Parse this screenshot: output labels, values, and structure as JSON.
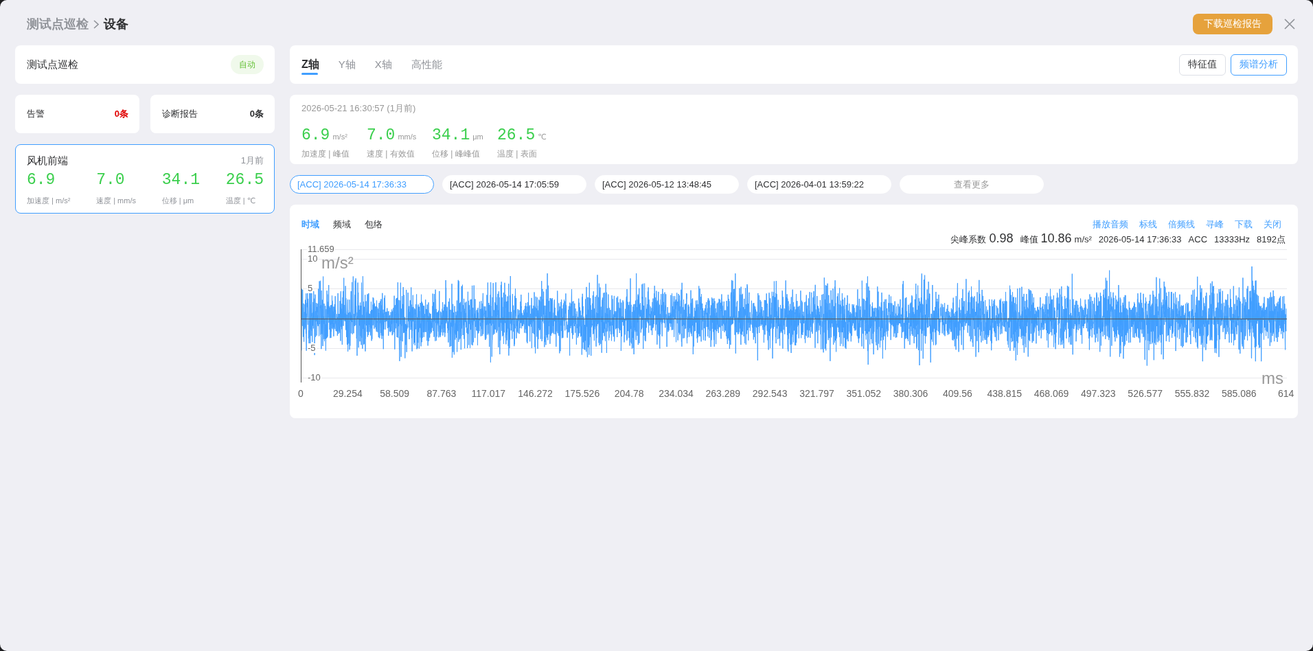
{
  "breadcrumb": [
    {
      "label": "测试点巡检",
      "current": false
    },
    {
      "label": "设备",
      "current": true
    }
  ],
  "header": {
    "download_button": "下载巡检报告"
  },
  "sidebar": {
    "patrol_card": {
      "title": "测试点巡检",
      "badge": "自动"
    },
    "counters": [
      {
        "label": "告警",
        "count": "0条",
        "color": "#e00000"
      },
      {
        "label": "诊断报告",
        "count": "0条",
        "color": "#303133"
      }
    ],
    "device_cards": [
      {
        "name": "风机前端",
        "time": "1月前",
        "selected": true,
        "readings": [
          {
            "value": "6.9",
            "label": "加速度 | m/s²"
          },
          {
            "value": "7.0",
            "label": "速度 | mm/s"
          },
          {
            "value": "34.1",
            "label": "位移 | μm"
          },
          {
            "value": "26.5",
            "label": "温度 | ℃"
          }
        ]
      }
    ]
  },
  "axis_tabs": [
    {
      "label": "Z轴",
      "selected": true
    },
    {
      "label": "Y轴",
      "selected": false
    },
    {
      "label": "X轴",
      "selected": false
    },
    {
      "label": "高性能",
      "selected": false
    }
  ],
  "tool_buttons": [
    {
      "label": "特征值",
      "selected": false
    },
    {
      "label": "频谱分析",
      "selected": true
    }
  ],
  "summary": {
    "timestamp": "2026-05-21 16:30:57 (1月前)",
    "metrics": [
      {
        "value": "6.9",
        "unit": "m/s²",
        "label": "加速度 | 峰值"
      },
      {
        "value": "7.0",
        "unit": "mm/s",
        "label": "速度 | 有效值"
      },
      {
        "value": "34.1",
        "unit": "μm",
        "label": "位移 | 峰峰值"
      },
      {
        "value": "26.5",
        "unit": "℃",
        "label": "温度 | 表面"
      }
    ]
  },
  "records": {
    "items": [
      {
        "label": "[ACC] 2026-05-14 17:36:33",
        "selected": true
      },
      {
        "label": "[ACC] 2026-05-14 17:05:59",
        "selected": false
      },
      {
        "label": "[ACC] 2026-05-12 13:48:45",
        "selected": false
      },
      {
        "label": "[ACC] 2026-04-01 13:59:22",
        "selected": false
      }
    ],
    "more_button": "查看更多"
  },
  "waveform_panel": {
    "view_tabs": [
      {
        "label": "时域",
        "selected": true
      },
      {
        "label": "频域",
        "selected": false
      },
      {
        "label": "包络",
        "selected": false
      }
    ],
    "actions": [
      "播放音频",
      "标线",
      "倍频线",
      "寻峰",
      "下载",
      "关闭"
    ],
    "stats": [
      {
        "label": "尖峰系数",
        "value": "0.98"
      },
      {
        "label": "峰值",
        "value": "10.86",
        "unit": "m/s²"
      }
    ],
    "info": [
      "2026-05-14 17:36:33",
      "ACC",
      "13333Hz",
      "8192点"
    ],
    "chart": {
      "y_unit": "m/s²",
      "x_unit": "ms",
      "y_tick_labels": [
        "11.659",
        "10",
        "5",
        "-5",
        "-10"
      ],
      "x_tick_labels": [
        "0",
        "29.254",
        "58.509",
        "87.763",
        "117.017",
        "146.272",
        "175.526",
        "204.78",
        "234.034",
        "263.289",
        "292.543",
        "321.797",
        "351.052",
        "380.306",
        "409.56",
        "438.815",
        "468.069",
        "497.323",
        "526.577",
        "555.832",
        "585.086",
        "614"
      ]
    }
  }
}
